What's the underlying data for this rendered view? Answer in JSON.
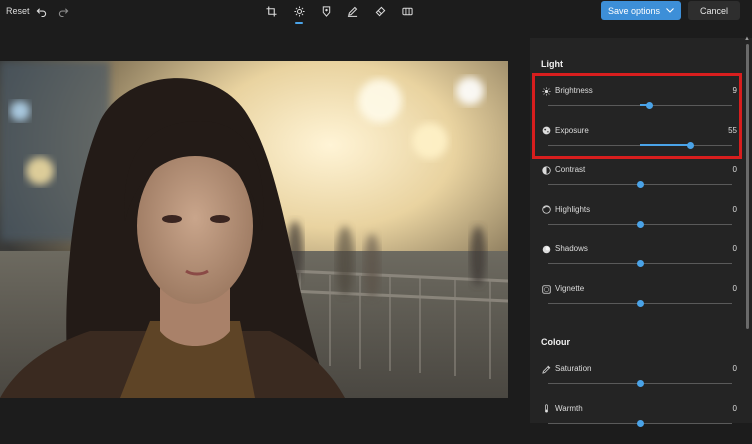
{
  "toolbar": {
    "reset_label": "Reset",
    "undo_icon": "undo-icon",
    "redo_icon": "redo-icon",
    "tools": [
      "crop-icon",
      "adjust-icon",
      "filter-icon",
      "markup-icon",
      "erase-icon",
      "effects-icon"
    ],
    "save_label": "Save options",
    "cancel_label": "Cancel"
  },
  "colors": {
    "accent": "#4aa3e8",
    "save_button": "#3d8fd8",
    "highlight": "#d81e1e",
    "panel": "#242424",
    "background": "#1c1c1c"
  },
  "panel": {
    "light_title": "Light",
    "colour_title": "Colour",
    "light": [
      {
        "label": "Brightness",
        "value": "9",
        "icon": "brightness-icon",
        "level": 0.55,
        "fill_from": 0.5
      },
      {
        "label": "Exposure",
        "value": "55",
        "icon": "exposure-icon",
        "level": 0.775,
        "fill_from": 0.5
      },
      {
        "label": "Contrast",
        "value": "0",
        "icon": "contrast-icon",
        "level": 0.5,
        "fill_from": 0.5
      },
      {
        "label": "Highlights",
        "value": "0",
        "icon": "highlights-icon",
        "level": 0.5,
        "fill_from": 0.5
      },
      {
        "label": "Shadows",
        "value": "0",
        "icon": "shadows-icon",
        "level": 0.5,
        "fill_from": 0.5
      },
      {
        "label": "Vignette",
        "value": "0",
        "icon": "vignette-icon",
        "level": 0.5,
        "fill_from": 0.5
      }
    ],
    "colour": [
      {
        "label": "Saturation",
        "value": "0",
        "icon": "saturation-icon",
        "level": 0.5,
        "fill_from": 0.5
      },
      {
        "label": "Warmth",
        "value": "0",
        "icon": "warmth-icon",
        "level": 0.5,
        "fill_from": 0.5
      }
    ]
  }
}
